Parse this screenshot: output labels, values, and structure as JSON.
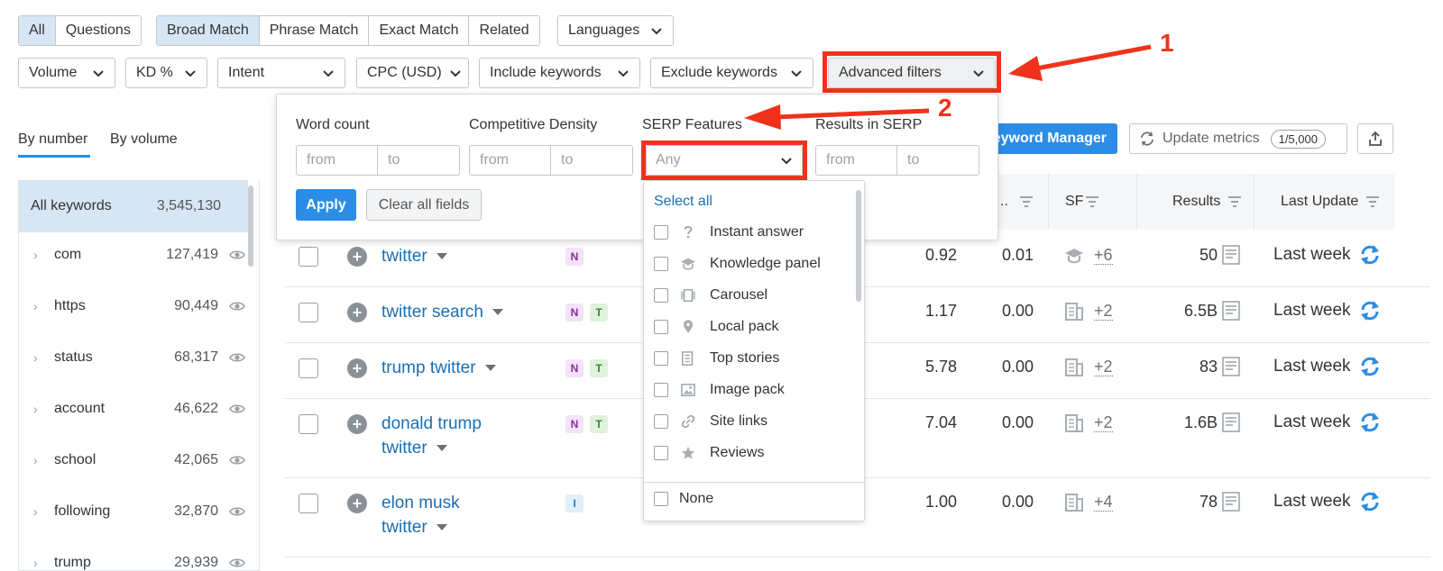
{
  "top_row1": {
    "type_tabs": [
      "All",
      "Questions"
    ],
    "match_tabs": [
      "Broad Match",
      "Phrase Match",
      "Exact Match",
      "Related"
    ],
    "languages_label": "Languages"
  },
  "filters": {
    "volume": "Volume",
    "kd": "KD %",
    "intent": "Intent",
    "cpc": "CPC (USD)",
    "include": "Include keywords",
    "exclude": "Exclude keywords",
    "advanced": "Advanced filters"
  },
  "annotations": {
    "one": "1",
    "two": "2",
    "accent": "#f0321c"
  },
  "group_tabs": {
    "by_number": "By number",
    "by_volume": "By volume"
  },
  "left_panel": {
    "all_label": "All keywords",
    "all_count": "3,545,130",
    "items": [
      {
        "label": "com",
        "count": "127,419"
      },
      {
        "label": "https",
        "count": "90,449"
      },
      {
        "label": "status",
        "count": "68,317"
      },
      {
        "label": "account",
        "count": "46,622"
      },
      {
        "label": "school",
        "count": "42,065"
      },
      {
        "label": "following",
        "count": "32,870"
      },
      {
        "label": "trump",
        "count": "29,939"
      }
    ]
  },
  "toolbar": {
    "keyword_manager": "eyword Manager",
    "update_metrics": "Update metrics",
    "update_badge": "1/5,000"
  },
  "popup": {
    "word_count": "Word count",
    "comp_density": "Competitive Density",
    "serp_features": "SERP Features",
    "results_in_serp": "Results in SERP",
    "from_placeholder": "from",
    "to_placeholder": "to",
    "serp_any": "Any",
    "apply": "Apply",
    "clear": "Clear all fields"
  },
  "serp_dropdown": {
    "select_all": "Select all",
    "items": [
      "Instant answer",
      "Knowledge panel",
      "Carousel",
      "Local pack",
      "Top stories",
      "Image pack",
      "Site links",
      "Reviews"
    ],
    "none": "None"
  },
  "table": {
    "headers": {
      "com": "..",
      "sf": "SF",
      "results": "Results",
      "last_update": "Last Update"
    },
    "rows": [
      {
        "kw1": "twitter",
        "kw2": "",
        "intents": [
          "N"
        ],
        "cpc": "0.92",
        "com": "0.01",
        "sf_more": "+6",
        "results": "50",
        "last": "Last week"
      },
      {
        "kw1": "twitter search",
        "kw2": "",
        "intents": [
          "N",
          "T"
        ],
        "cpc": "1.17",
        "com": "0.00",
        "sf_more": "+2",
        "results": "6.5B",
        "last": "Last week"
      },
      {
        "kw1": "trump twitter",
        "kw2": "",
        "intents": [
          "N",
          "T"
        ],
        "cpc": "5.78",
        "com": "0.00",
        "sf_more": "+2",
        "results": "83",
        "last": "Last week"
      },
      {
        "kw1": "donald trump",
        "kw2": "twitter",
        "intents": [
          "N",
          "T"
        ],
        "cpc": "7.04",
        "com": "0.00",
        "sf_more": "+2",
        "results": "1.6B",
        "last": "Last week"
      },
      {
        "kw1": "elon musk",
        "kw2": "twitter",
        "intents": [
          "I"
        ],
        "cpc": "1.00",
        "com": "0.00",
        "sf_more": "+4",
        "results": "78",
        "last": "Last week"
      }
    ]
  }
}
